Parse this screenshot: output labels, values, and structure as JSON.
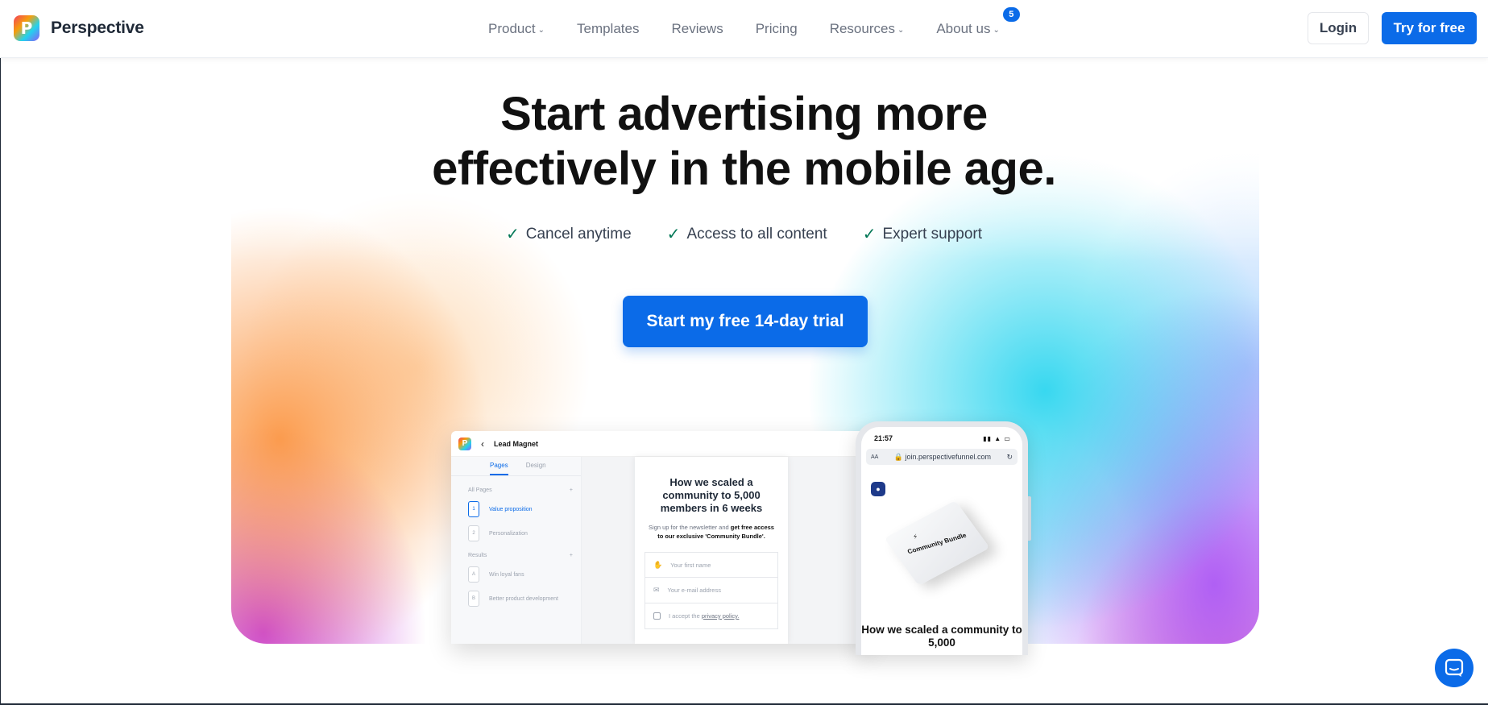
{
  "header": {
    "brand": "Perspective",
    "logo_letter": "P",
    "nav": [
      {
        "label": "Product",
        "has_caret": true
      },
      {
        "label": "Templates",
        "has_caret": false
      },
      {
        "label": "Reviews",
        "has_caret": false
      },
      {
        "label": "Pricing",
        "has_caret": false
      },
      {
        "label": "Resources",
        "has_caret": true
      },
      {
        "label": "About us",
        "has_caret": true,
        "badge": "5"
      }
    ],
    "login_label": "Login",
    "try_label": "Try for free"
  },
  "hero": {
    "title_line1": "Start advertising more",
    "title_line2": "effectively in the mobile age.",
    "features": [
      "Cancel anytime",
      "Access to all content",
      "Expert support"
    ],
    "cta_label": "Start my free 14-day trial"
  },
  "editor": {
    "title": "Lead Magnet",
    "tabs": [
      "Pages",
      "Design"
    ],
    "group_all": "All Pages",
    "pages": [
      {
        "num": "1",
        "label": "Value proposition"
      },
      {
        "num": "2",
        "label": "Personalization"
      }
    ],
    "group_results": "Results",
    "results": [
      {
        "num": "A",
        "label": "Win loyal fans"
      },
      {
        "num": "B",
        "label": "Better product development"
      }
    ],
    "page_heading": "How we scaled a community to 5,000 members in 6 weeks",
    "page_sub_plain": "Sign up for the newsletter and ",
    "page_sub_bold": "get free access to our exclusive 'Community Bundle'.",
    "field_name": "Your first name",
    "field_email": "Your e-mail address",
    "field_accept": "I accept the",
    "field_policy": "privacy policy."
  },
  "phone": {
    "time": "21:57",
    "url": "join.perspectivefunnel.com",
    "text_size_label": "AA",
    "box_label": "Community Bundle",
    "heading": "How we scaled a community to 5,000"
  },
  "colors": {
    "accent": "#0b6be8",
    "check": "#047857"
  }
}
